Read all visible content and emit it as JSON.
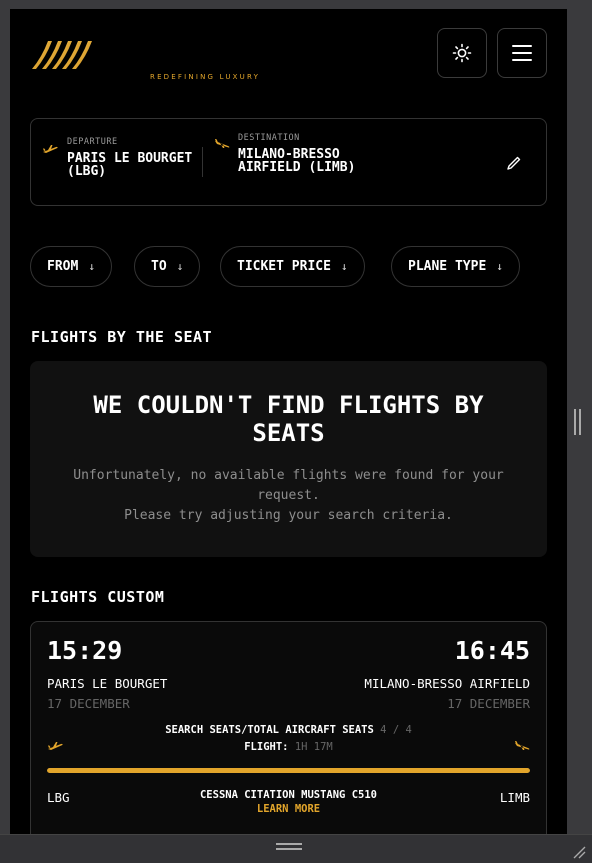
{
  "header": {
    "tagline": "REDEFINING LUXURY",
    "theme_icon": "sun-icon",
    "menu_icon": "hamburger-menu-icon",
    "brand_color": "#e2a52b"
  },
  "route": {
    "departure_label": "DEPARTURE",
    "departure_value": "PARIS LE BOURGET (LBG)",
    "destination_label": "DESTINATION",
    "destination_value": "MILANO-BRESSO AIRFIELD (LIMB)",
    "edit_icon": "pencil-icon"
  },
  "filters": [
    {
      "label": "FROM",
      "icon": "arrow-down-icon"
    },
    {
      "label": "TO",
      "icon": "arrow-down-icon"
    },
    {
      "label": "TICKET PRICE",
      "icon": "arrow-down-icon"
    },
    {
      "label": "PLANE TYPE",
      "icon": "arrow-down-icon"
    }
  ],
  "seat_section": {
    "title": "FLIGHTS BY THE SEAT",
    "empty_title": "WE COULDN'T FIND FLIGHTS BY SEATS",
    "empty_line1": "Unfortunately, no available flights were found for your request.",
    "empty_line2": "Please try adjusting your search criteria."
  },
  "custom_section": {
    "title": "FLIGHTS CUSTOM",
    "flight": {
      "dep_time": "15:29",
      "arr_time": "16:45",
      "dep_city": "PARIS LE BOURGET",
      "arr_city": "MILANO-BRESSO AIRFIELD",
      "dep_date": "17 DECEMBER",
      "arr_date": "17 DECEMBER",
      "seats_label": "SEARCH SEATS/TOTAL AIRCRAFT SEATS",
      "seats_value": "4 / 4",
      "flight_label": "FLIGHT:",
      "flight_value": "1H 17M",
      "progress_fraction": 1.0,
      "dep_code": "LBG",
      "arr_code": "LIMB",
      "aircraft": "CESSNA CITATION MUSTANG C510",
      "learn_more": "LEARN MORE"
    }
  }
}
